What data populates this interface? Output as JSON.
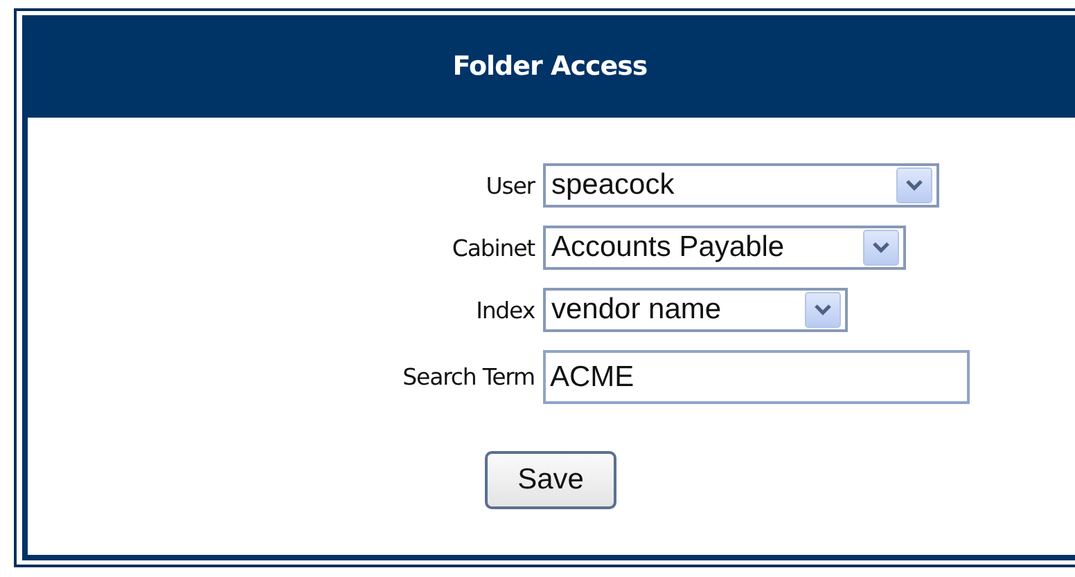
{
  "panel": {
    "title": "Folder Access"
  },
  "fields": [
    {
      "label": "User",
      "kind": "select",
      "value": "speacock"
    },
    {
      "label": "Cabinet",
      "kind": "select",
      "value": "Accounts Payable"
    },
    {
      "label": "Index",
      "kind": "select",
      "value": "vendor name"
    },
    {
      "label": "Search Term",
      "kind": "text",
      "value": "ACME"
    }
  ],
  "buttons": [
    "Save"
  ]
}
